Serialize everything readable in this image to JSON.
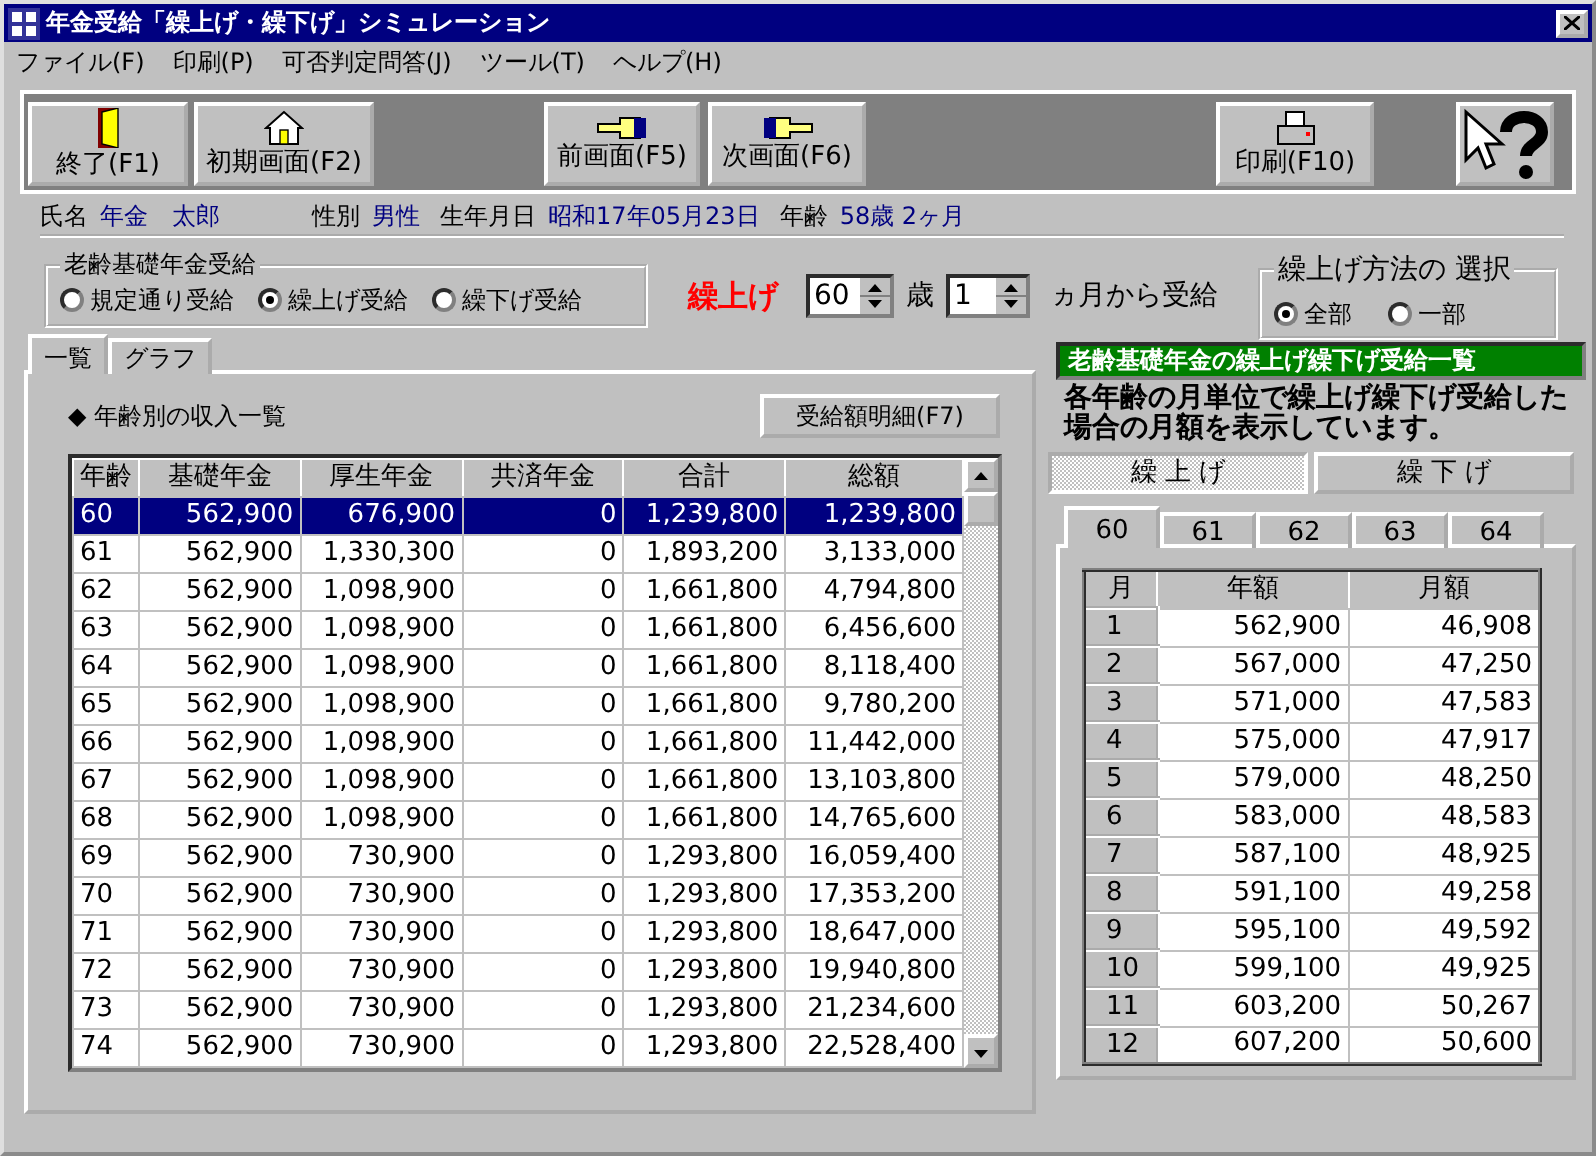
{
  "window": {
    "title": "年金受給「繰上げ・繰下げ」シミュレーション"
  },
  "menu": [
    "ファイル(F)",
    "印刷(P)",
    "可否判定問答(J)",
    "ツール(T)",
    "ヘルプ(H)"
  ],
  "toolbar": [
    {
      "kind": "exit",
      "label": "終了(F1)"
    },
    {
      "kind": "home",
      "label": "初期画面(F2)"
    },
    {
      "kind": "back",
      "label": "前画面(F5)"
    },
    {
      "kind": "next",
      "label": "次画面(F6)"
    },
    {
      "kind": "print",
      "label": "印刷(F10)"
    },
    {
      "kind": "help"
    }
  ],
  "person": [
    {
      "label": "氏名",
      "value": "年金　太郎"
    },
    {
      "label": "性別",
      "value": "男性"
    },
    {
      "label": "生年月日",
      "value": "昭和17年05月23日"
    },
    {
      "label": "年齢",
      "value": "58歳 2ヶ月"
    }
  ],
  "basic_pension": {
    "title": "老齢基礎年金受給",
    "options": [
      {
        "label": "規定通り受給",
        "selected": false
      },
      {
        "label": "繰上げ受給",
        "selected": true
      },
      {
        "label": "繰下げ受給",
        "selected": false
      }
    ]
  },
  "start": {
    "mode": "繰上げ",
    "age": "60",
    "age_unit": "歳",
    "month": "1",
    "month_unit": "ヵ月から受給"
  },
  "method": {
    "title": "繰上げ方法の 選択",
    "options": [
      {
        "label": "全部",
        "selected": true
      },
      {
        "label": "一部",
        "selected": false
      }
    ]
  },
  "tabs": [
    {
      "label": "一覧",
      "selected": true
    },
    {
      "label": "グラフ",
      "selected": false
    }
  ],
  "income": {
    "heading": "◆ 年齢別の収入一覧",
    "detail_button": "受給額明細(F7)",
    "columns": [
      "年齢",
      "基礎年金",
      "厚生年金",
      "共済年金",
      "合計",
      "総額"
    ],
    "rows": [
      {
        "cells": [
          "60",
          "562,900",
          "676,900",
          "0",
          "1,239,800",
          "1,239,800"
        ],
        "selected": true
      },
      {
        "cells": [
          "61",
          "562,900",
          "1,330,300",
          "0",
          "1,893,200",
          "3,133,000"
        ],
        "selected": false
      },
      {
        "cells": [
          "62",
          "562,900",
          "1,098,900",
          "0",
          "1,661,800",
          "4,794,800"
        ],
        "selected": false
      },
      {
        "cells": [
          "63",
          "562,900",
          "1,098,900",
          "0",
          "1,661,800",
          "6,456,600"
        ],
        "selected": false
      },
      {
        "cells": [
          "64",
          "562,900",
          "1,098,900",
          "0",
          "1,661,800",
          "8,118,400"
        ],
        "selected": false
      },
      {
        "cells": [
          "65",
          "562,900",
          "1,098,900",
          "0",
          "1,661,800",
          "9,780,200"
        ],
        "selected": false
      },
      {
        "cells": [
          "66",
          "562,900",
          "1,098,900",
          "0",
          "1,661,800",
          "11,442,000"
        ],
        "selected": false
      },
      {
        "cells": [
          "67",
          "562,900",
          "1,098,900",
          "0",
          "1,661,800",
          "13,103,800"
        ],
        "selected": false
      },
      {
        "cells": [
          "68",
          "562,900",
          "1,098,900",
          "0",
          "1,661,800",
          "14,765,600"
        ],
        "selected": false
      },
      {
        "cells": [
          "69",
          "562,900",
          "730,900",
          "0",
          "1,293,800",
          "16,059,400"
        ],
        "selected": false
      },
      {
        "cells": [
          "70",
          "562,900",
          "730,900",
          "0",
          "1,293,800",
          "17,353,200"
        ],
        "selected": false
      },
      {
        "cells": [
          "71",
          "562,900",
          "730,900",
          "0",
          "1,293,800",
          "18,647,000"
        ],
        "selected": false
      },
      {
        "cells": [
          "72",
          "562,900",
          "730,900",
          "0",
          "1,293,800",
          "19,940,800"
        ],
        "selected": false
      },
      {
        "cells": [
          "73",
          "562,900",
          "730,900",
          "0",
          "1,293,800",
          "21,234,600"
        ],
        "selected": false
      },
      {
        "cells": [
          "74",
          "562,900",
          "730,900",
          "0",
          "1,293,800",
          "22,528,400"
        ],
        "selected": false
      }
    ]
  },
  "monthly": {
    "title": "老齢基礎年金の繰上げ繰下げ受給一覧",
    "description": "各年齢の月単位で繰上げ繰下げ受給した場合の月額を表示しています。",
    "modes": [
      {
        "label": "繰 上 げ",
        "selected": true
      },
      {
        "label": "繰 下 げ",
        "selected": false
      }
    ],
    "age_tabs": [
      {
        "label": "60",
        "selected": true
      },
      {
        "label": "61",
        "selected": false
      },
      {
        "label": "62",
        "selected": false
      },
      {
        "label": "63",
        "selected": false
      },
      {
        "label": "64",
        "selected": false
      }
    ],
    "columns": [
      "月",
      "年額",
      "月額"
    ],
    "rows": [
      [
        "1",
        "562,900",
        "46,908"
      ],
      [
        "2",
        "567,000",
        "47,250"
      ],
      [
        "3",
        "571,000",
        "47,583"
      ],
      [
        "4",
        "575,000",
        "47,917"
      ],
      [
        "5",
        "579,000",
        "48,250"
      ],
      [
        "6",
        "583,000",
        "48,583"
      ],
      [
        "7",
        "587,100",
        "48,925"
      ],
      [
        "8",
        "591,100",
        "49,258"
      ],
      [
        "9",
        "595,100",
        "49,592"
      ],
      [
        "10",
        "599,100",
        "49,925"
      ],
      [
        "11",
        "603,200",
        "50,267"
      ],
      [
        "12",
        "607,200",
        "50,600"
      ]
    ]
  }
}
